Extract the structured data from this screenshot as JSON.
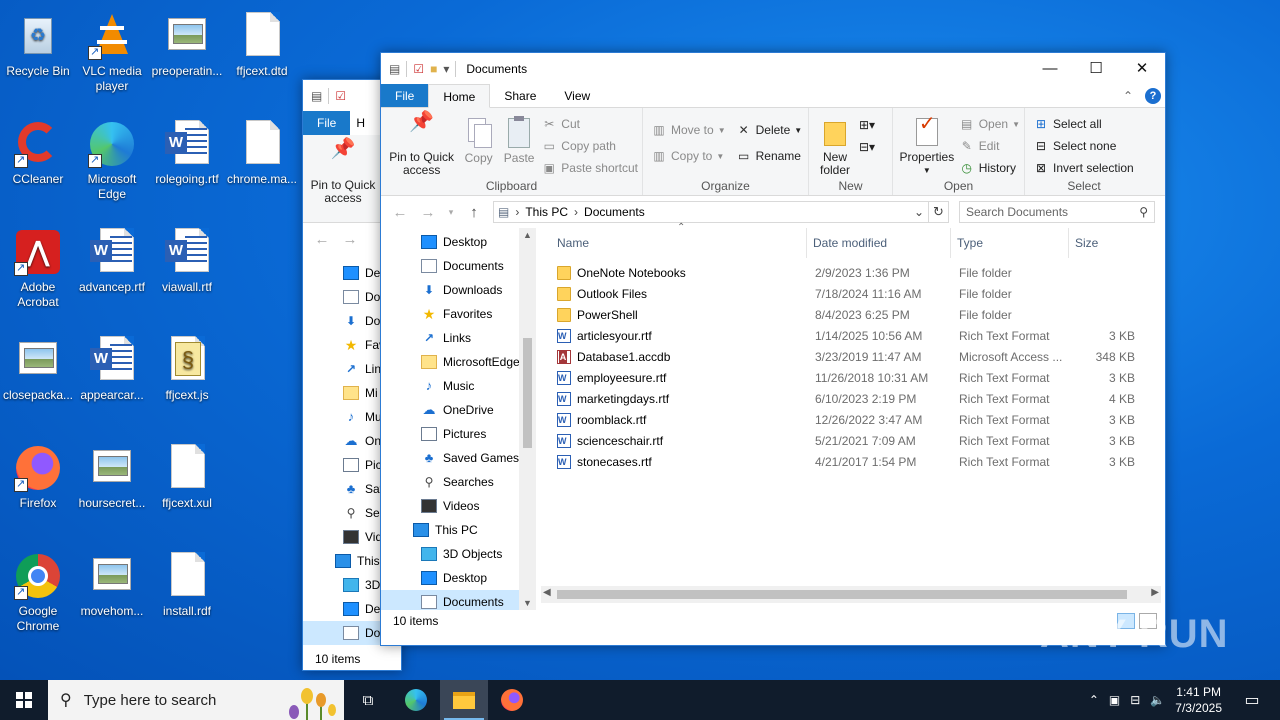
{
  "desktop": {
    "icons": [
      {
        "label": "Recycle Bin",
        "icon": "recycle-bin-icon"
      },
      {
        "label": "VLC media player",
        "icon": "vlc-icon"
      },
      {
        "label": "preoperatin...",
        "icon": "image-file-icon"
      },
      {
        "label": "ffjcext.dtd",
        "icon": "blank-file-icon"
      },
      {
        "label": "CCleaner",
        "icon": "ccleaner-icon"
      },
      {
        "label": "Microsoft Edge",
        "icon": "edge-icon"
      },
      {
        "label": "rolegoing.rtf",
        "icon": "word-doc-icon"
      },
      {
        "label": "chrome.ma...",
        "icon": "blank-file-icon"
      },
      {
        "label": "Adobe Acrobat",
        "icon": "acrobat-icon"
      },
      {
        "label": "advancep.rtf",
        "icon": "word-doc-icon"
      },
      {
        "label": "viawall.rtf",
        "icon": "word-doc-icon"
      },
      {
        "label": "closepacka...",
        "icon": "image-file-icon"
      },
      {
        "label": "appearcar...",
        "icon": "word-doc-icon"
      },
      {
        "label": "ffjcext.js",
        "icon": "script-file-icon"
      },
      {
        "label": "Firefox",
        "icon": "firefox-icon"
      },
      {
        "label": "hoursecret...",
        "icon": "image-file-icon"
      },
      {
        "label": "ffjcext.xul",
        "icon": "blank-file-icon"
      },
      {
        "label": "Google Chrome",
        "icon": "chrome-icon"
      },
      {
        "label": "movehom...",
        "icon": "image-file-icon"
      },
      {
        "label": "install.rdf",
        "icon": "blank-file-icon"
      }
    ]
  },
  "back_window": {
    "tab_file": "File",
    "tab_home_partial": "H",
    "pin_label": "Pin to Quick access",
    "nav_items": [
      "Des",
      "Do",
      "Do",
      "Fav",
      "Lin",
      "Mi",
      "Mu",
      "On",
      "Pic",
      "Sav",
      "Sea",
      "Vid",
      "This",
      "3D",
      "Des",
      "Do"
    ],
    "status": "10 items"
  },
  "window": {
    "title": "Documents",
    "tabs": {
      "file": "File",
      "home": "Home",
      "share": "Share",
      "view": "View"
    },
    "ribbon": {
      "clipboard": {
        "group": "Clipboard",
        "pin": "Pin to Quick access",
        "copy": "Copy",
        "paste": "Paste",
        "cut": "Cut",
        "copy_path": "Copy path",
        "paste_shortcut": "Paste shortcut"
      },
      "organize": {
        "group": "Organize",
        "move_to": "Move to",
        "copy_to": "Copy to",
        "delete": "Delete",
        "rename": "Rename"
      },
      "new": {
        "group": "New",
        "new_folder": "New folder"
      },
      "open": {
        "group": "Open",
        "properties": "Properties",
        "open": "Open",
        "edit": "Edit",
        "history": "History"
      },
      "select": {
        "group": "Select",
        "select_all": "Select all",
        "select_none": "Select none",
        "invert": "Invert selection"
      }
    },
    "address": {
      "crumb1": "This PC",
      "crumb2": "Documents"
    },
    "search_placeholder": "Search Documents",
    "nav": [
      {
        "label": "Desktop",
        "icon": "desktop-icon"
      },
      {
        "label": "Documents",
        "icon": "documents-icon"
      },
      {
        "label": "Downloads",
        "icon": "downloads-icon"
      },
      {
        "label": "Favorites",
        "icon": "favorites-icon"
      },
      {
        "label": "Links",
        "icon": "links-icon"
      },
      {
        "label": "MicrosoftEdge",
        "icon": "folder-icon"
      },
      {
        "label": "Music",
        "icon": "music-icon"
      },
      {
        "label": "OneDrive",
        "icon": "onedrive-icon"
      },
      {
        "label": "Pictures",
        "icon": "pictures-icon"
      },
      {
        "label": "Saved Games",
        "icon": "saved-games-icon"
      },
      {
        "label": "Searches",
        "icon": "searches-icon"
      },
      {
        "label": "Videos",
        "icon": "videos-icon"
      },
      {
        "label": "This PC",
        "icon": "this-pc-icon"
      },
      {
        "label": "3D Objects",
        "icon": "3d-objects-icon"
      },
      {
        "label": "Desktop",
        "icon": "desktop-icon"
      },
      {
        "label": "Documents",
        "icon": "documents-icon"
      }
    ],
    "columns": {
      "name": "Name",
      "date": "Date modified",
      "type": "Type",
      "size": "Size"
    },
    "files": [
      {
        "name": "OneNote Notebooks",
        "date": "2/9/2023 1:36 PM",
        "type": "File folder",
        "size": "",
        "kind": "folder"
      },
      {
        "name": "Outlook Files",
        "date": "7/18/2024 11:16 AM",
        "type": "File folder",
        "size": "",
        "kind": "folder"
      },
      {
        "name": "PowerShell",
        "date": "8/4/2023 6:25 PM",
        "type": "File folder",
        "size": "",
        "kind": "folder"
      },
      {
        "name": "articlesyour.rtf",
        "date": "1/14/2025 10:56 AM",
        "type": "Rich Text Format",
        "size": "3 KB",
        "kind": "rtf"
      },
      {
        "name": "Database1.accdb",
        "date": "3/23/2019 11:47 AM",
        "type": "Microsoft Access ...",
        "size": "348 KB",
        "kind": "access"
      },
      {
        "name": "employeesure.rtf",
        "date": "11/26/2018 10:31 AM",
        "type": "Rich Text Format",
        "size": "3 KB",
        "kind": "rtf"
      },
      {
        "name": "marketingdays.rtf",
        "date": "6/10/2023 2:19 PM",
        "type": "Rich Text Format",
        "size": "4 KB",
        "kind": "rtf"
      },
      {
        "name": "roomblack.rtf",
        "date": "12/26/2022 3:47 AM",
        "type": "Rich Text Format",
        "size": "3 KB",
        "kind": "rtf"
      },
      {
        "name": "scienceschair.rtf",
        "date": "5/21/2021 7:09 AM",
        "type": "Rich Text Format",
        "size": "3 KB",
        "kind": "rtf"
      },
      {
        "name": "stonecases.rtf",
        "date": "4/21/2017 1:54 PM",
        "type": "Rich Text Format",
        "size": "3 KB",
        "kind": "rtf"
      }
    ],
    "status": "10 items"
  },
  "taskbar": {
    "search_placeholder": "Type here to search",
    "time": "1:41 PM",
    "date": "7/3/2025"
  },
  "watermark": "ANY RUN"
}
